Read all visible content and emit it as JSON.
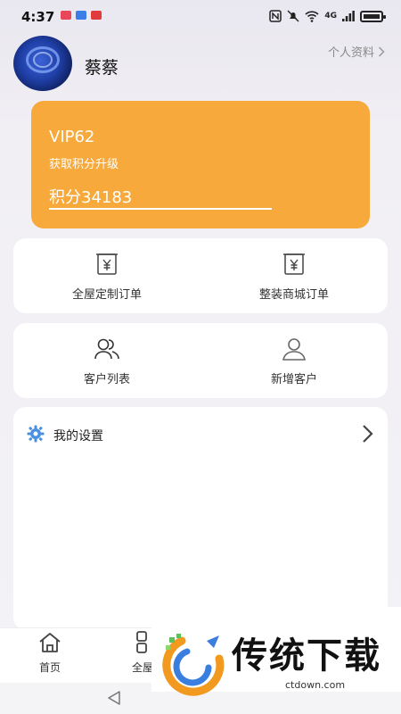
{
  "status_bar": {
    "time": "4:37",
    "network": "4G",
    "app_colors": [
      "#e8465a",
      "#3b7ee8",
      "#e03a3a"
    ]
  },
  "profile": {
    "name": "蔡蔡",
    "link_label": "个人资料"
  },
  "vip": {
    "level": "VIP62",
    "hint": "获取积分升级",
    "points": "积分34183",
    "color": "#f7a93b"
  },
  "orders": {
    "items": [
      {
        "label": "全屋定制订单",
        "icon": "yen-receipt-icon"
      },
      {
        "label": "整装商城订单",
        "icon": "yen-receipt-icon"
      }
    ]
  },
  "customers": {
    "items": [
      {
        "label": "客户列表",
        "icon": "users-icon"
      },
      {
        "label": "新增客户",
        "icon": "user-add-icon"
      }
    ]
  },
  "settings": {
    "label": "我的设置",
    "icon": "gear-icon",
    "accent": "#4a8fe0"
  },
  "bottom_nav": {
    "items": [
      {
        "label": "首页",
        "icon": "home-icon"
      },
      {
        "label": "全屋",
        "icon": "grid-icon"
      }
    ]
  },
  "watermark": {
    "text": "传统下载",
    "url": "ctdown.com"
  }
}
